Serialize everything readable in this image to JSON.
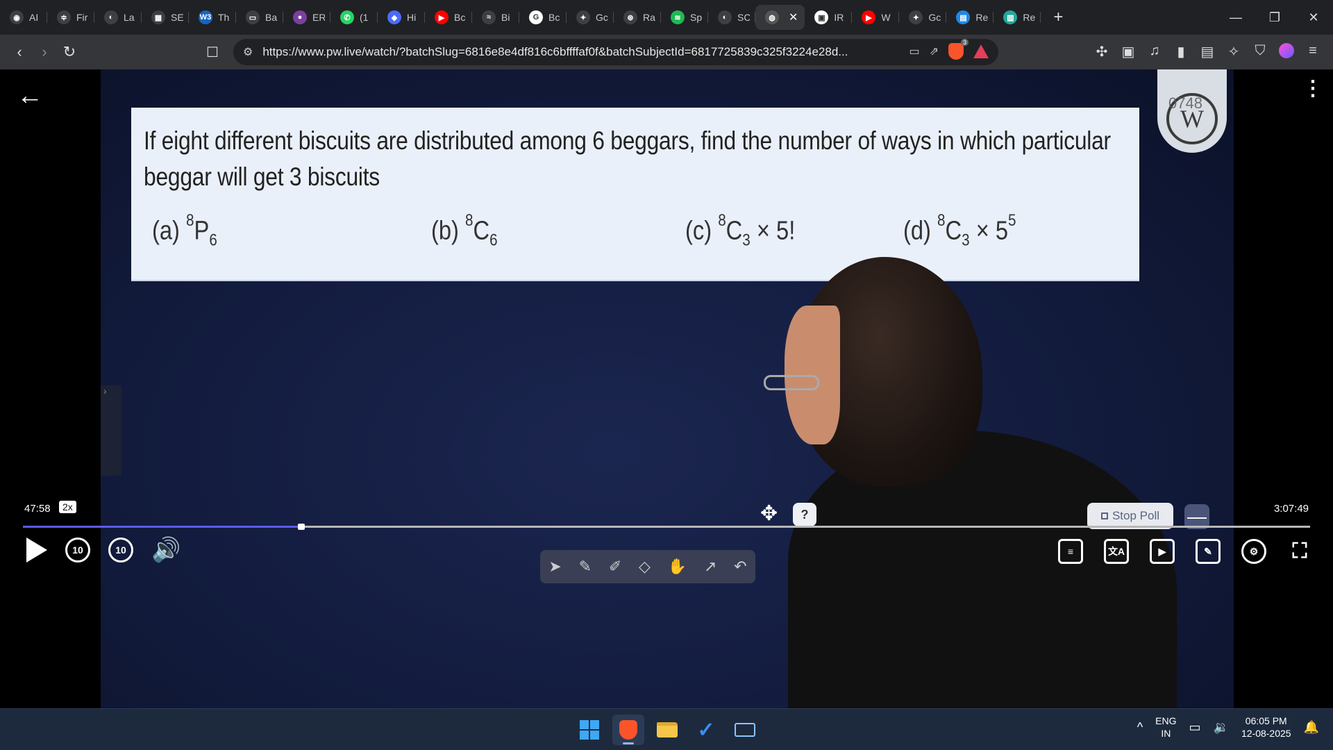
{
  "browser": {
    "tabs": [
      {
        "title": "AI",
        "color": "#3c4043",
        "glyph": "◉"
      },
      {
        "title": "Fir",
        "color": "#3c4043",
        "glyph": "≑"
      },
      {
        "title": "La",
        "color": "#3c4043",
        "glyph": "◐"
      },
      {
        "title": "SE",
        "color": "#3c4043",
        "glyph": "▦"
      },
      {
        "title": "Th",
        "color": "#1565c0",
        "glyph": "W3"
      },
      {
        "title": "Ba",
        "color": "#3c4043",
        "glyph": "▭"
      },
      {
        "title": "ER",
        "color": "#7b3fa0",
        "glyph": "●"
      },
      {
        "title": "(1",
        "color": "#25d366",
        "glyph": "✆"
      },
      {
        "title": "Hi",
        "color": "#4a6cf7",
        "glyph": "◆"
      },
      {
        "title": "Bc",
        "color": "#ff0000",
        "glyph": "▶"
      },
      {
        "title": "Bi",
        "color": "#3c4043",
        "glyph": "≈"
      },
      {
        "title": "Bc",
        "color": "#ffffff",
        "glyph": "G"
      },
      {
        "title": "Gc",
        "color": "#3c4043",
        "glyph": "✦"
      },
      {
        "title": "Ra",
        "color": "#3c4043",
        "glyph": "⊛"
      },
      {
        "title": "Sp",
        "color": "#1db954",
        "glyph": "≋"
      },
      {
        "title": "SC",
        "color": "#3c4043",
        "glyph": "◐"
      },
      {
        "title": "",
        "color": "#555555",
        "glyph": "◍",
        "active": true
      },
      {
        "title": "IR",
        "color": "#ffffff",
        "glyph": "▣"
      },
      {
        "title": "W",
        "color": "#ff0000",
        "glyph": "▶"
      },
      {
        "title": "Gc",
        "color": "#3c4043",
        "glyph": "✦"
      },
      {
        "title": "Re",
        "color": "#1e88e5",
        "glyph": "▤"
      },
      {
        "title": "Re",
        "color": "#26a69a",
        "glyph": "▥"
      }
    ],
    "url": "https://www.pw.live/watch/?batchSlug=6816e8e4df816c6bffffaf0f&batchSubjectId=6817725839c325f3224e28d...",
    "brave_badge": "3"
  },
  "question": {
    "text": "If eight different biscuits are distributed among 6 beggars, find the number of ways in which particular beggar will get 3 biscuits",
    "options": [
      {
        "label": "(a)",
        "pre": "8",
        "main": "P",
        "sub": "6",
        "post": ""
      },
      {
        "label": "(b)",
        "pre": "8",
        "main": "C",
        "sub": "6",
        "post": ""
      },
      {
        "label": "(c)",
        "pre": "8",
        "main": "C",
        "sub": "3",
        "post": " × 5!"
      },
      {
        "label": "(d)",
        "pre": "8",
        "main": "C",
        "sub": "3",
        "post": " × 5",
        "post_sup": "5"
      }
    ]
  },
  "watermark": "0748",
  "player": {
    "current_time": "47:58",
    "speed": "2x",
    "duration": "3:07:49",
    "progress_fraction": 0.2155,
    "skip_back": "10",
    "skip_forward": "10",
    "stop_poll": "Stop Poll",
    "help": "?",
    "minus": "—"
  },
  "taskbar": {
    "lang_line1": "ENG",
    "lang_line2": "IN",
    "time": "06:05 PM",
    "date": "12-08-2025"
  }
}
